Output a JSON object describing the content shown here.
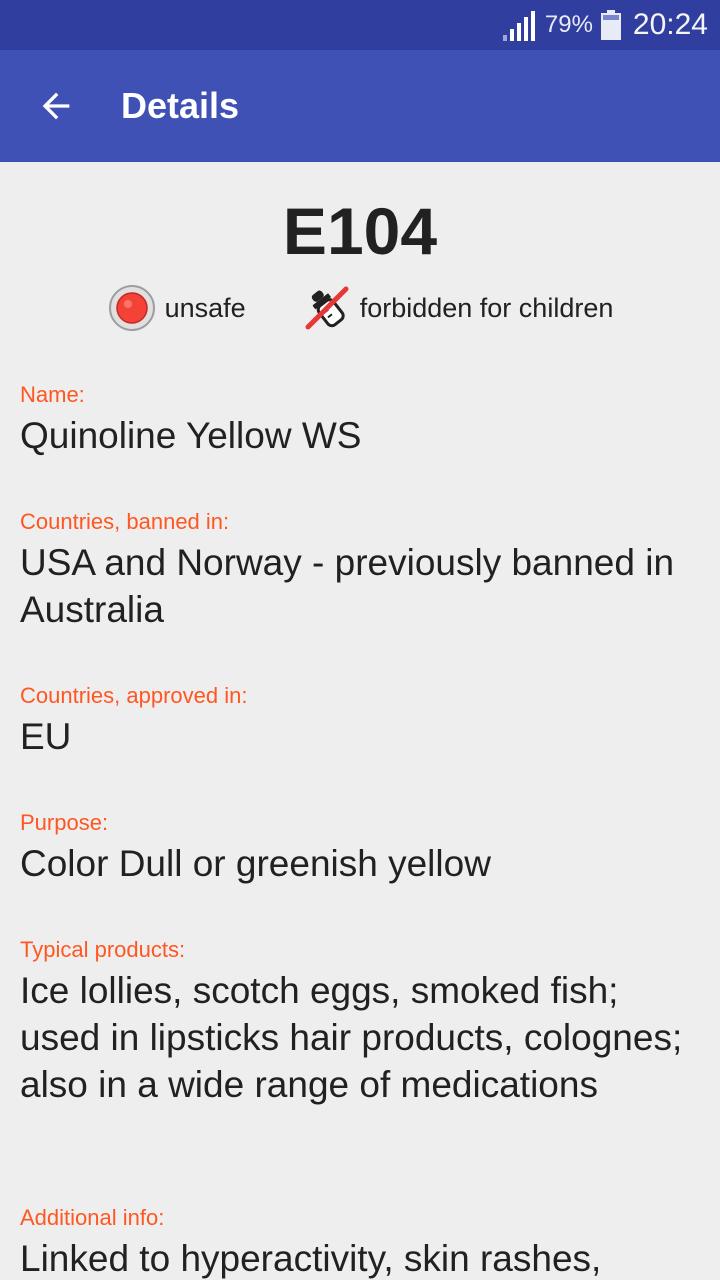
{
  "status_bar": {
    "battery_percent": "79%",
    "time": "20:24",
    "icons": [
      "signal-icon",
      "battery-icon"
    ]
  },
  "app_bar": {
    "title": "Details",
    "back_icon": "arrow-back-icon"
  },
  "additive": {
    "code": "E104",
    "badges": [
      {
        "icon": "unsafe-icon",
        "label": "unsafe",
        "color": "#f44336"
      },
      {
        "icon": "forbidden-for-children-icon",
        "label": "forbidden for children",
        "color": "#e53935"
      }
    ]
  },
  "fields": [
    {
      "label": "Name:",
      "value": "Quinoline Yellow WS"
    },
    {
      "label": "Countries, banned in:",
      "value": "USA and Norway - previously banned in Australia"
    },
    {
      "label": "Countries, approved in:",
      "value": "EU"
    },
    {
      "label": "Purpose:",
      "value": "Color Dull or greenish yellow"
    },
    {
      "label": "Typical products:",
      "value": "Ice lollies, scotch eggs, smoked fish; used in lipsticks hair products, colognes; also in a wide range of medications"
    },
    {
      "label": "Additional info:",
      "value": "Linked to hyperactivity, skin rashes, asthmatics"
    }
  ],
  "colors": {
    "status_bar": "#303f9f",
    "app_bar": "#3f51b5",
    "label_accent": "#ff5722",
    "background": "#eeeeee"
  }
}
